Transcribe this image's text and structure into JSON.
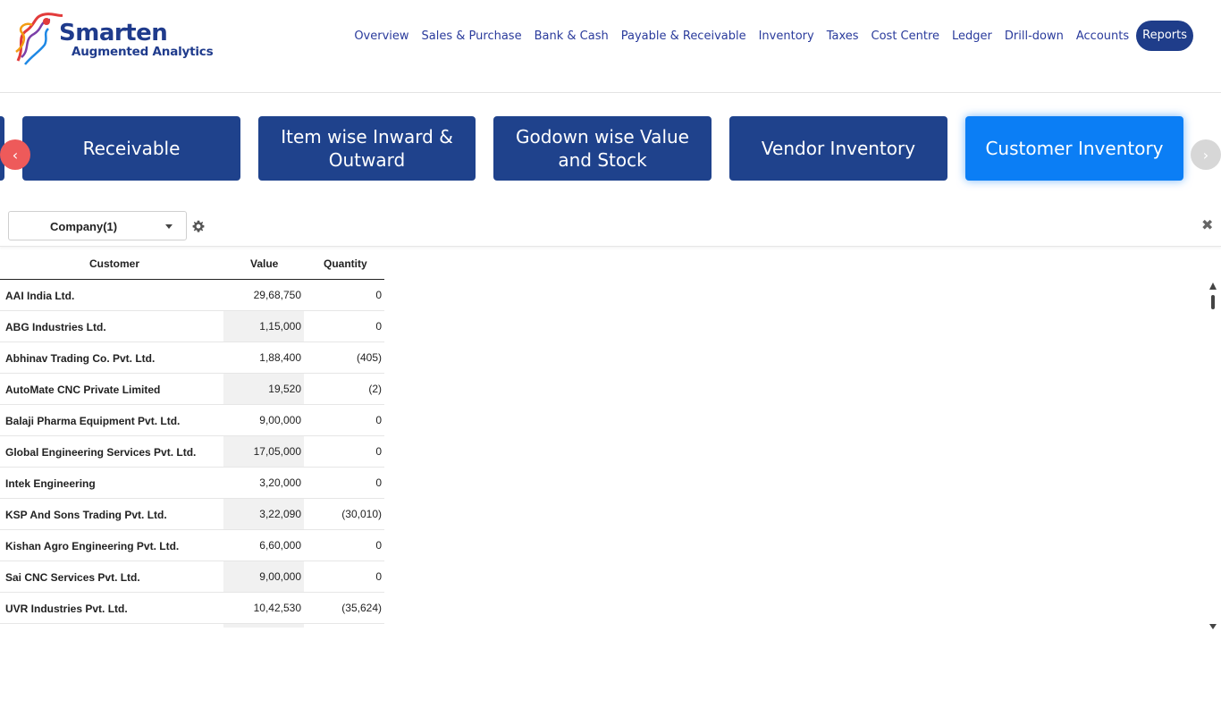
{
  "brand": {
    "name": "Smarten",
    "tagline": "Augmented Analytics"
  },
  "nav": {
    "items": [
      {
        "label": "Overview"
      },
      {
        "label": "Sales & Purchase"
      },
      {
        "label": "Bank & Cash"
      },
      {
        "label": "Payable & Receivable"
      },
      {
        "label": "Inventory"
      },
      {
        "label": "Taxes"
      },
      {
        "label": "Cost Centre"
      },
      {
        "label": "Ledger"
      },
      {
        "label": "Drill-down"
      },
      {
        "label": "Accounts"
      },
      {
        "label": "Reports",
        "active": true
      }
    ]
  },
  "carousel": {
    "prev_icon": "chevron-left-icon",
    "next_icon": "chevron-right-icon",
    "prev_glyph": "‹",
    "next_glyph": "›",
    "cards": [
      {
        "label": "Receivable"
      },
      {
        "label": "Item wise Inward & Outward"
      },
      {
        "label": "Godown wise Value and Stock"
      },
      {
        "label": "Vendor Inventory"
      },
      {
        "label": "Customer Inventory",
        "active": true
      }
    ]
  },
  "filter": {
    "company_select": "Company(1)",
    "close_glyph": "✖"
  },
  "table": {
    "headers": {
      "customer": "Customer",
      "value": "Value",
      "quantity": "Quantity"
    },
    "rows": [
      {
        "customer": "AAI India Ltd.",
        "value": "29,68,750",
        "quantity": "0"
      },
      {
        "customer": "ABG Industries Ltd.",
        "value": "1,15,000",
        "quantity": "0"
      },
      {
        "customer": "Abhinav Trading Co. Pvt. Ltd.",
        "value": "1,88,400",
        "quantity": "(405)"
      },
      {
        "customer": "AutoMate CNC Private Limited",
        "value": "19,520",
        "quantity": "(2)"
      },
      {
        "customer": "Balaji Pharma Equipment Pvt. Ltd.",
        "value": "9,00,000",
        "quantity": "0"
      },
      {
        "customer": "Global Engineering Services Pvt. Ltd.",
        "value": "17,05,000",
        "quantity": "0"
      },
      {
        "customer": "Intek Engineering",
        "value": "3,20,000",
        "quantity": "0"
      },
      {
        "customer": "KSP And Sons Trading Pvt. Ltd.",
        "value": "3,22,090",
        "quantity": "(30,010)"
      },
      {
        "customer": "Kishan Agro Engineering Pvt. Ltd.",
        "value": "6,60,000",
        "quantity": "0"
      },
      {
        "customer": "Sai CNC Services Pvt. Ltd.",
        "value": "9,00,000",
        "quantity": "0"
      },
      {
        "customer": "UVR Industries Pvt. Ltd.",
        "value": "10,42,530",
        "quantity": "(35,624)"
      }
    ]
  },
  "colors": {
    "brand_blue": "#1f3d8a",
    "card_blue": "#1f428c",
    "card_active": "#0b7ef5",
    "nav_text": "#2a3b9c",
    "prev_arrow": "#ee5a5a",
    "next_arrow": "#d7d7d7"
  }
}
